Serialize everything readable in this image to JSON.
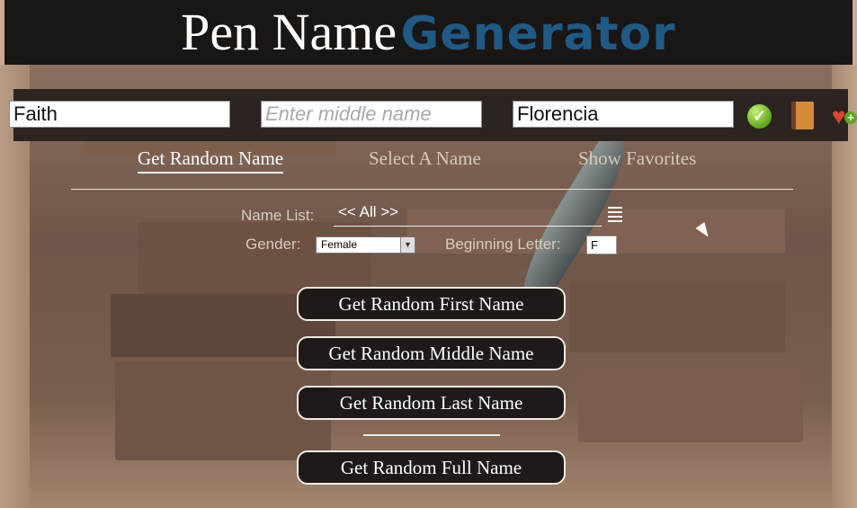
{
  "header": {
    "title_part1": "Pen Name",
    "title_part2": "Generator",
    "title_part2_color": "#1e5a85"
  },
  "name_bar": {
    "first_value": "Faith",
    "middle_value": "",
    "middle_placeholder": "Enter middle name",
    "last_value": "Florencia",
    "icons": [
      "check-icon",
      "book-icon",
      "heart-plus-icon"
    ]
  },
  "tabs": [
    {
      "label": "Get Random Name",
      "active": true
    },
    {
      "label": "Select A Name",
      "active": false
    },
    {
      "label": "Show Favorites",
      "active": false
    }
  ],
  "form": {
    "name_list_label": "Name List:",
    "name_list_value": "<< All >>",
    "gender_label": "Gender:",
    "gender_value": "Female",
    "beginning_letter_label": "Beginning Letter:",
    "beginning_letter_value": "F"
  },
  "buttons": {
    "first": "Get Random First Name",
    "middle": "Get Random Middle Name",
    "last": "Get Random Last Name",
    "full": "Get Random Full Name"
  }
}
